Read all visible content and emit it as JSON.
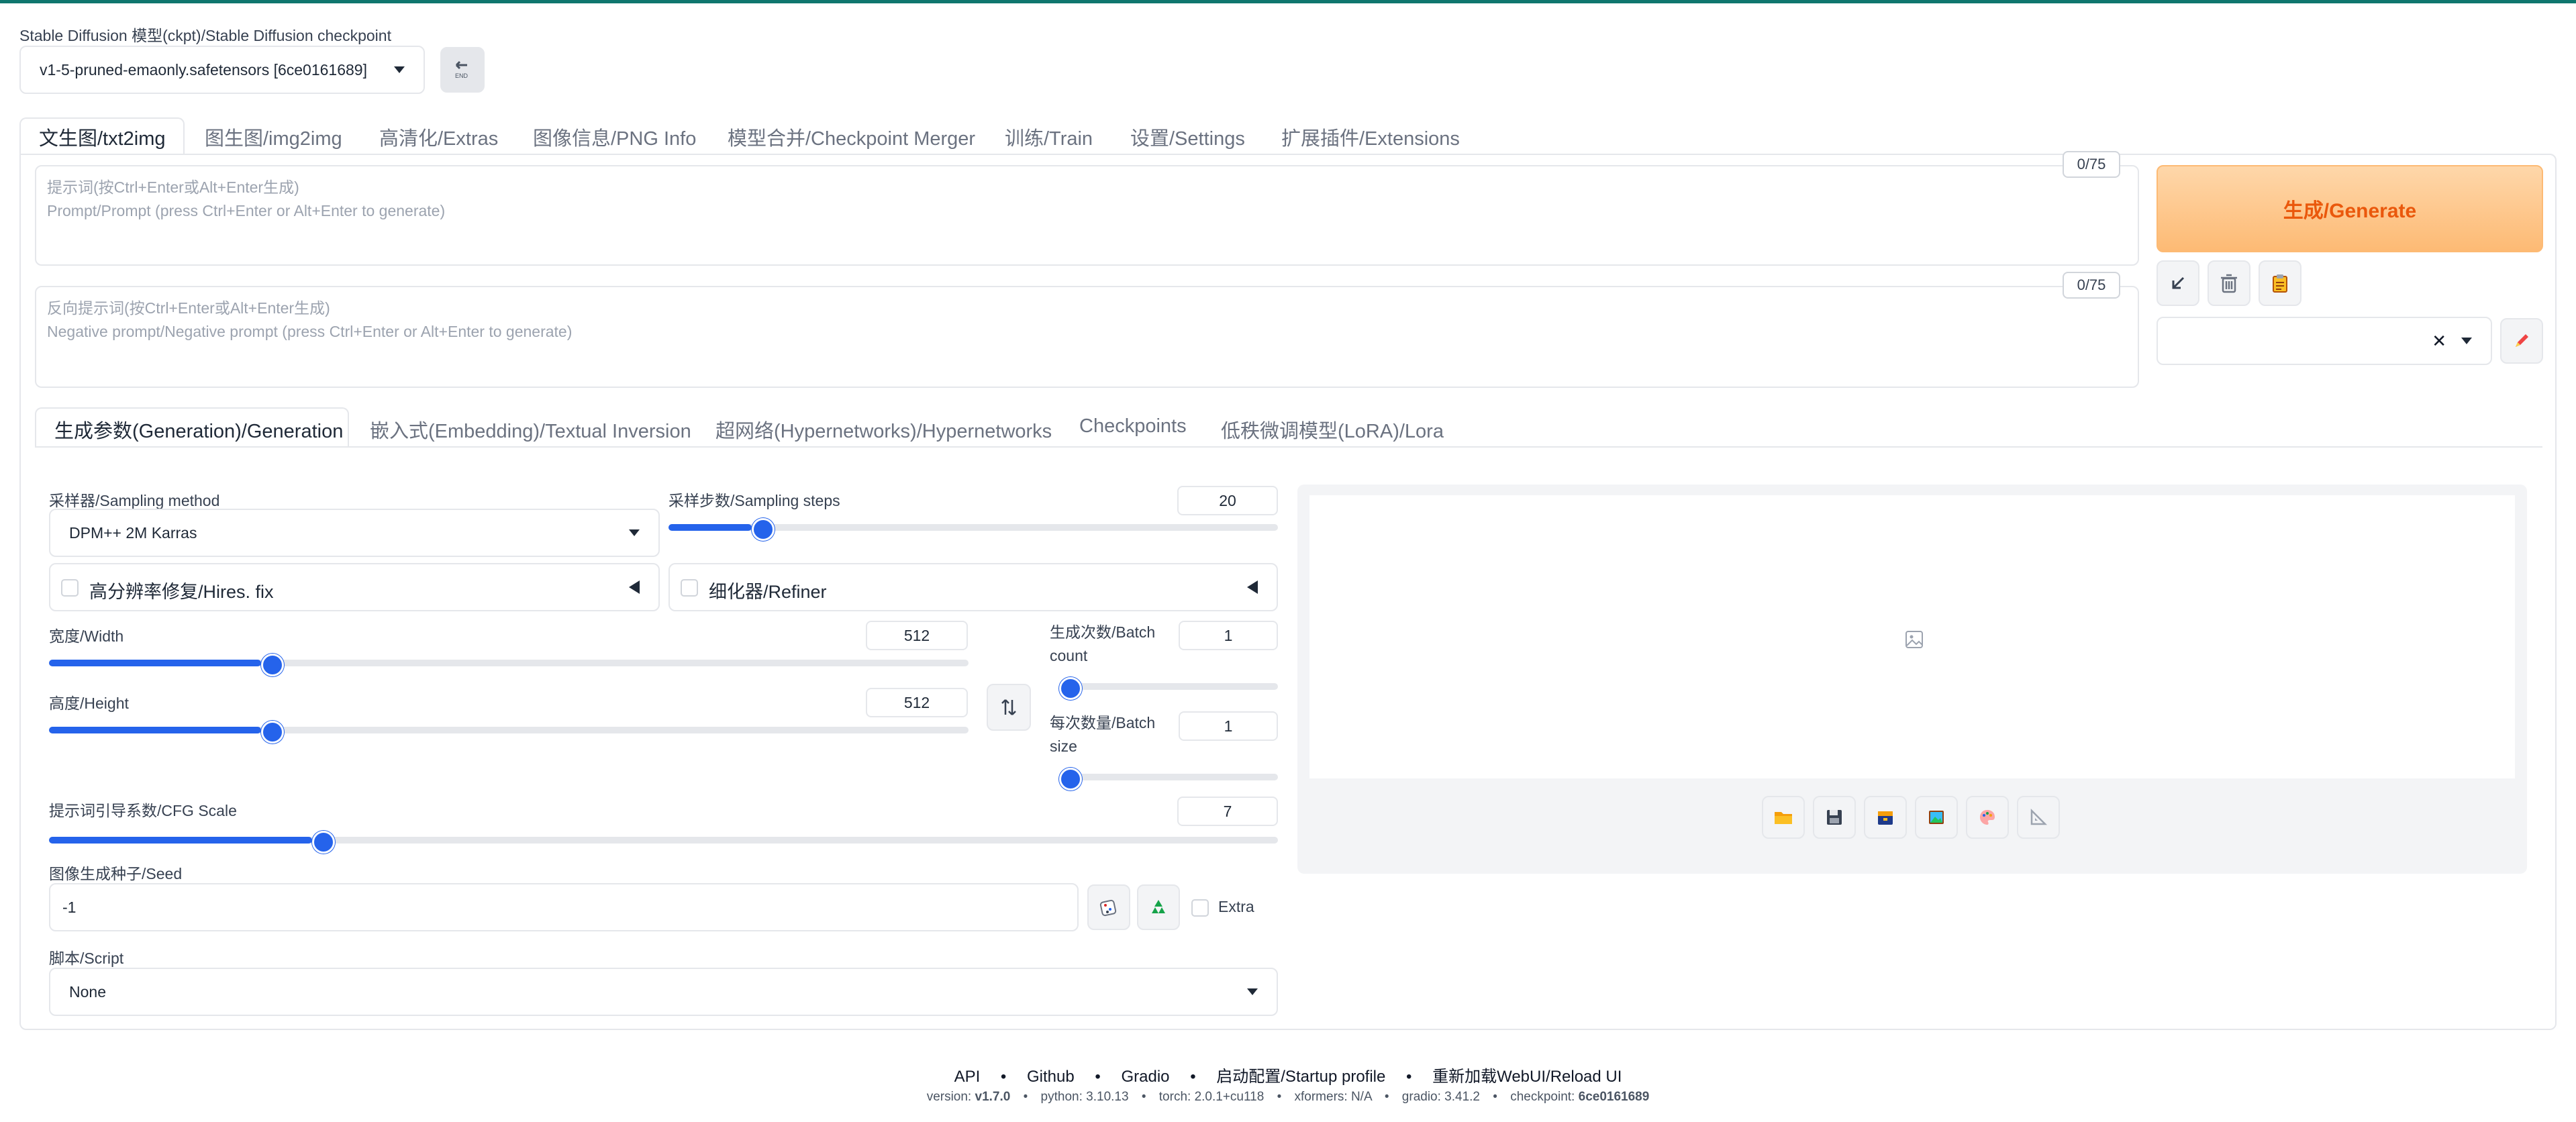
{
  "checkpoint": {
    "label": "Stable Diffusion 模型(ckpt)/Stable Diffusion checkpoint",
    "value": "v1-5-pruned-emaonly.safetensors [6ce0161689]"
  },
  "main_tabs": [
    {
      "label": "文生图/txt2img"
    },
    {
      "label": "图生图/img2img"
    },
    {
      "label": "高清化/Extras"
    },
    {
      "label": "图像信息/PNG Info"
    },
    {
      "label": "模型合并/Checkpoint Merger"
    },
    {
      "label": "训练/Train"
    },
    {
      "label": "设置/Settings"
    },
    {
      "label": "扩展插件/Extensions"
    }
  ],
  "prompt": {
    "counter": "0/75",
    "placeholder_line1": "提示词(按Ctrl+Enter或Alt+Enter生成)",
    "placeholder_line2": "Prompt/Prompt (press Ctrl+Enter or Alt+Enter to generate)"
  },
  "negative_prompt": {
    "counter": "0/75",
    "placeholder_line1": "反向提示词(按Ctrl+Enter或Alt+Enter生成)",
    "placeholder_line2": "Negative prompt/Negative prompt (press Ctrl+Enter or Alt+Enter to generate)"
  },
  "generate_label": "生成/Generate",
  "clear_symbol": "✕",
  "sub_tabs": [
    {
      "label": "生成参数(Generation)/Generation"
    },
    {
      "label": "嵌入式(Embedding)/Textual Inversion"
    },
    {
      "label": "超网络(Hypernetworks)/Hypernetworks"
    },
    {
      "label": "Checkpoints"
    },
    {
      "label": "低秩微调模型(LoRA)/Lora"
    }
  ],
  "sampler": {
    "label": "采样器/Sampling method",
    "value": "DPM++ 2M Karras"
  },
  "steps": {
    "label": "采样步数/Sampling steps",
    "value": "20",
    "fraction": 0.137
  },
  "hires": {
    "label": "高分辨率修复/Hires. fix"
  },
  "refiner": {
    "label": "细化器/Refiner"
  },
  "width": {
    "label": "宽度/Width",
    "value": "512",
    "fraction": 0.231
  },
  "height": {
    "label": "高度/Height",
    "value": "512",
    "fraction": 0.231
  },
  "batch_count": {
    "label_line1": "生成次数/Batch",
    "label_line2": "count",
    "value": "1",
    "fraction": 0.0
  },
  "batch_size": {
    "label_line1": "每次数量/Batch",
    "label_line2": "size",
    "value": "1",
    "fraction": 0.0
  },
  "cfg": {
    "label": "提示词引导系数/CFG Scale",
    "value": "7",
    "fraction": 0.214
  },
  "seed": {
    "label": "图像生成种子/Seed",
    "value": "-1",
    "extra_label": "Extra"
  },
  "script": {
    "label": "脚本/Script",
    "value": "None"
  },
  "footer": {
    "links": [
      "API",
      "Github",
      "Gradio",
      "启动配置/Startup profile",
      "重新加载WebUI/Reload UI"
    ],
    "separator": "•",
    "version_label": "version:",
    "version": "v1.7.0",
    "python": "python: 3.10.13",
    "torch": "torch: 2.0.1+cu118",
    "xformers": "xformers: N/A",
    "gradio": "gradio: 3.41.2",
    "checkpoint_label": "checkpoint:",
    "checkpoint": "6ce0161689"
  },
  "colors": {
    "accent": "#2563eb",
    "generate": "#ea580c",
    "topbar": "#0f766e"
  }
}
